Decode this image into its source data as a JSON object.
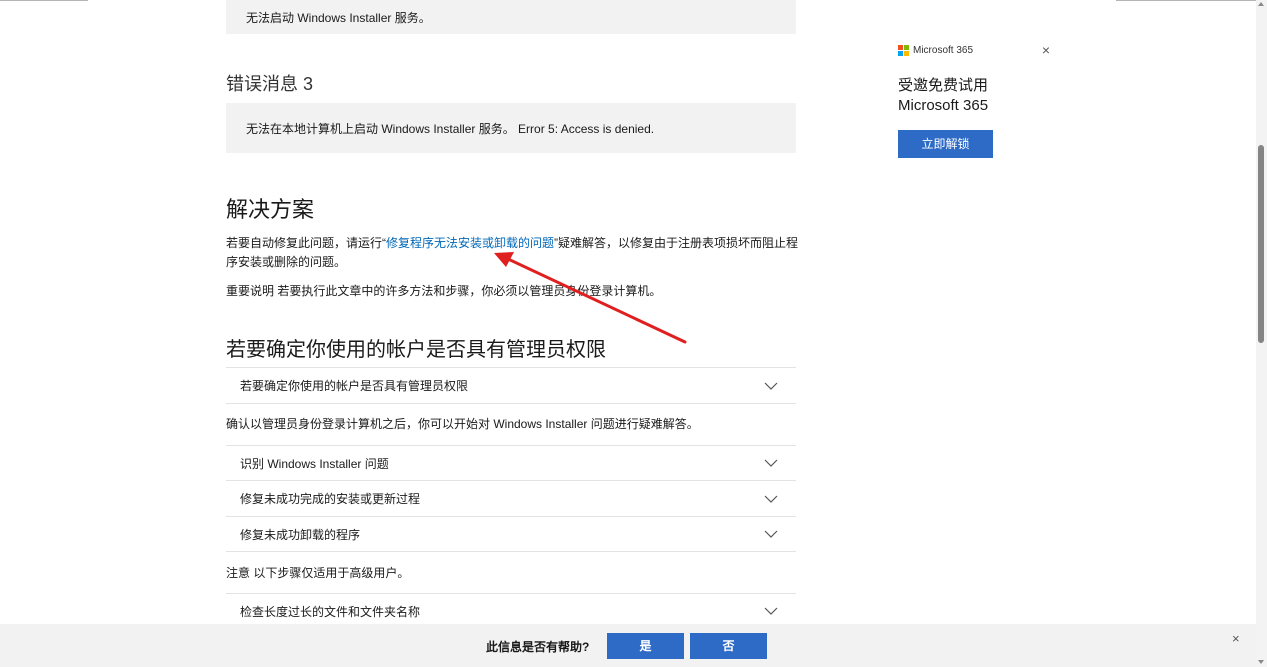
{
  "error_box_1": {
    "text": "无法启动 Windows Installer 服务。"
  },
  "error_3": {
    "heading": "错误消息 3",
    "text": "无法在本地计算机上启动 Windows Installer 服务。 Error 5: Access is denied."
  },
  "solution": {
    "heading": "解决方案",
    "p1_before": "若要自动修复此问题，请运行“",
    "p1_link": "修复程序无法安装或卸载的问题",
    "p1_after": "”疑难解答，以修复由于注册表项损坏而阻止程序安装或删除的问题。",
    "p2": "重要说明 若要执行此文章中的许多方法和步骤，你必须以管理员身份登录计算机。"
  },
  "admin": {
    "heading": "若要确定你使用的帐户是否具有管理员权限",
    "accordion_1": "若要确定你使用的帐户是否具有管理员权限",
    "p3": "确认以管理员身份登录计算机之后，你可以开始对 Windows Installer 问题进行疑难解答。",
    "accordion_2": "识别 Windows Installer 问题",
    "accordion_3": "修复未成功完成的安装或更新过程",
    "accordion_4": "修复未成功卸载的程序",
    "p4": "注意 以下步骤仅适用于高级用户。",
    "accordion_5": "检查长度过长的文件和文件夹名称"
  },
  "ad": {
    "brand": "Microsoft 365",
    "title_line1": "受邀免费试用",
    "title_line2": "Microsoft 365",
    "button": "立即解锁",
    "close": "×",
    "logo_colors": [
      "#f25022",
      "#7fba00",
      "#00a4ef",
      "#ffb900"
    ]
  },
  "feedback": {
    "question": "此信息是否有帮助?",
    "yes": "是",
    "no": "否",
    "close": "×"
  },
  "colors": {
    "link": "#0067b8",
    "button": "#2e6bc7",
    "annotation_arrow": "#e02020"
  }
}
